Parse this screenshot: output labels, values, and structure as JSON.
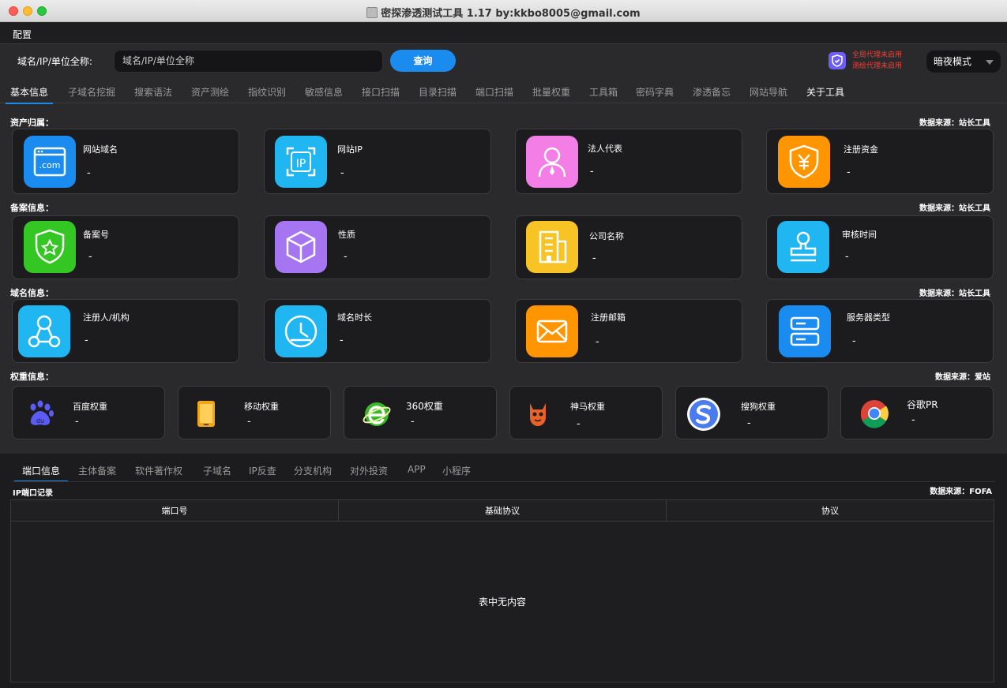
{
  "window": {
    "title": "密探渗透测试工具 1.17 by:kkbo8005@gmail.com"
  },
  "menu": {
    "config": "配置"
  },
  "toolbar": {
    "label": "域名/IP/单位全称:",
    "input_placeholder": "域名/IP/单位全称",
    "query_button": "查询",
    "proxy_global": "全局代理未启用",
    "proxy_mapping": "测绘代理未启用",
    "mode_select": "暗夜模式"
  },
  "tabs": [
    "基本信息",
    "子域名挖掘",
    "搜索语法",
    "资产测绘",
    "指纹识别",
    "敏感信息",
    "接口扫描",
    "目录扫描",
    "端口扫描",
    "批量权重",
    "工具箱",
    "密码字典",
    "渗透备忘",
    "网站导航",
    "关于工具"
  ],
  "sections": {
    "asset": {
      "title": "资产归属：",
      "source": "数据来源：站长工具",
      "cards": [
        {
          "label": "网站域名",
          "value": "-",
          "icon": "website-domain-icon",
          "color": "#1a8cf0"
        },
        {
          "label": "网站IP",
          "value": "-",
          "icon": "website-ip-icon",
          "color": "#1fb6f2"
        },
        {
          "label": "法人代表",
          "value": "-",
          "icon": "legal-person-icon",
          "color": "#f27ee6"
        },
        {
          "label": "注册资金",
          "value": "-",
          "icon": "registered-capital-icon",
          "color": "#ff9500"
        }
      ]
    },
    "record": {
      "title": "备案信息：",
      "source": "数据来源：站长工具",
      "cards": [
        {
          "label": "备案号",
          "value": "-",
          "icon": "record-number-icon",
          "color": "#34c724"
        },
        {
          "label": "性质",
          "value": "-",
          "icon": "nature-cube-icon",
          "color": "#a675f2"
        },
        {
          "label": "公司名称",
          "value": "-",
          "icon": "company-building-icon",
          "color": "#f7c325"
        },
        {
          "label": "审核时间",
          "value": "-",
          "icon": "review-stamp-icon",
          "color": "#1fb6f2"
        }
      ]
    },
    "domain": {
      "title": "域名信息：",
      "source": "数据来源：站长工具",
      "cards": [
        {
          "label": "注册人/机构",
          "value": "-",
          "icon": "registrant-icon",
          "color": "#1fb6f2"
        },
        {
          "label": "域名时长",
          "value": "-",
          "icon": "clock-icon",
          "color": "#1fb6f2"
        },
        {
          "label": "注册邮箱",
          "value": "-",
          "icon": "mail-icon",
          "color": "#ff9500"
        },
        {
          "label": "服务器类型",
          "value": "-",
          "icon": "server-icon",
          "color": "#1a8cf0"
        }
      ]
    },
    "weight": {
      "title": "权重信息：",
      "source": "数据来源：爱站",
      "cards": [
        {
          "label": "百度权重",
          "value": "-",
          "icon": "baidu-icon"
        },
        {
          "label": "移动权重",
          "value": "-",
          "icon": "mobile-icon"
        },
        {
          "label": "360权重",
          "value": "-",
          "icon": "360-browser-icon"
        },
        {
          "label": "神马权重",
          "value": "-",
          "icon": "shenma-icon"
        },
        {
          "label": "搜狗权重",
          "value": "-",
          "icon": "sogou-icon"
        },
        {
          "label": "谷歌PR",
          "value": "-",
          "icon": "chrome-icon"
        }
      ]
    }
  },
  "subtabs": [
    "端口信息",
    "主体备案",
    "软件著作权",
    "子域名",
    "IP反查",
    "分支机构",
    "对外投资",
    "APP",
    "小程序"
  ],
  "port_panel": {
    "title": "IP端口记录",
    "source": "数据来源：FOFA",
    "columns": [
      "端口号",
      "基础协议",
      "协议"
    ],
    "empty_text": "表中无内容"
  },
  "colors": {
    "accent": "#1a8cf0",
    "background": "#2a2a2d",
    "card": "#1c1c1e",
    "warning": "#ff3b30"
  }
}
